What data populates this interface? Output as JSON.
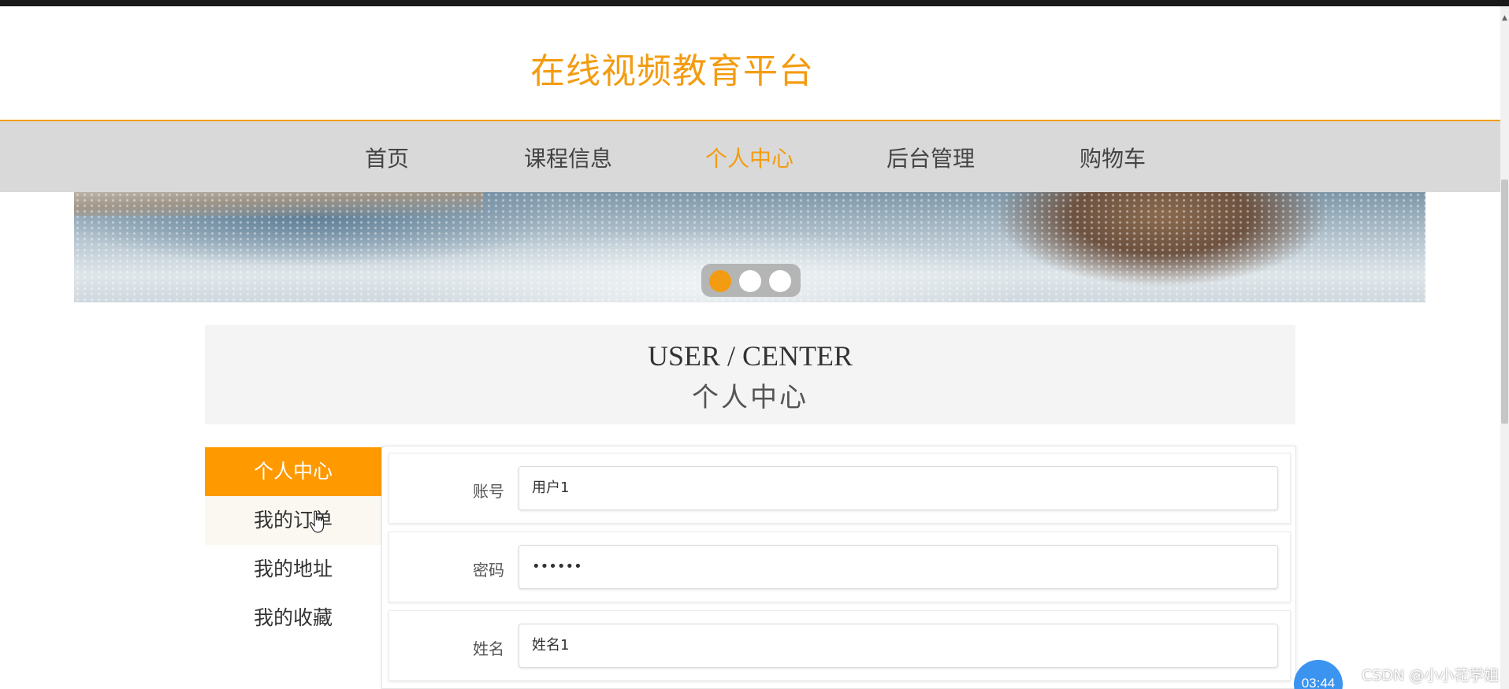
{
  "site": {
    "title": "在线视频教育平台"
  },
  "nav": {
    "items": [
      {
        "label": "首页"
      },
      {
        "label": "课程信息"
      },
      {
        "label": "个人中心",
        "active": true
      },
      {
        "label": "后台管理"
      },
      {
        "label": "购物车"
      }
    ]
  },
  "banner": {
    "active_slide": 1,
    "slide_count": 3
  },
  "user_center": {
    "title_en": "USER / CENTER",
    "title_cn": "个人中心"
  },
  "side_menu": {
    "items": [
      {
        "label": "个人中心",
        "active": true
      },
      {
        "label": "我的订单"
      },
      {
        "label": "我的地址"
      },
      {
        "label": "我的收藏"
      }
    ]
  },
  "form": {
    "fields": [
      {
        "label": "账号",
        "value": "用户1"
      },
      {
        "label": "密码",
        "value": "••••••"
      },
      {
        "label": "姓名",
        "value": "姓名1"
      }
    ]
  },
  "overlay": {
    "timer": "03:44",
    "watermark": "CSDN @小小花学姐"
  },
  "colors": {
    "accent": "#f39c12",
    "menu_active": "#ff9900",
    "nav_bg": "#d9d9d9",
    "timer_bg": "#3a94f0"
  }
}
